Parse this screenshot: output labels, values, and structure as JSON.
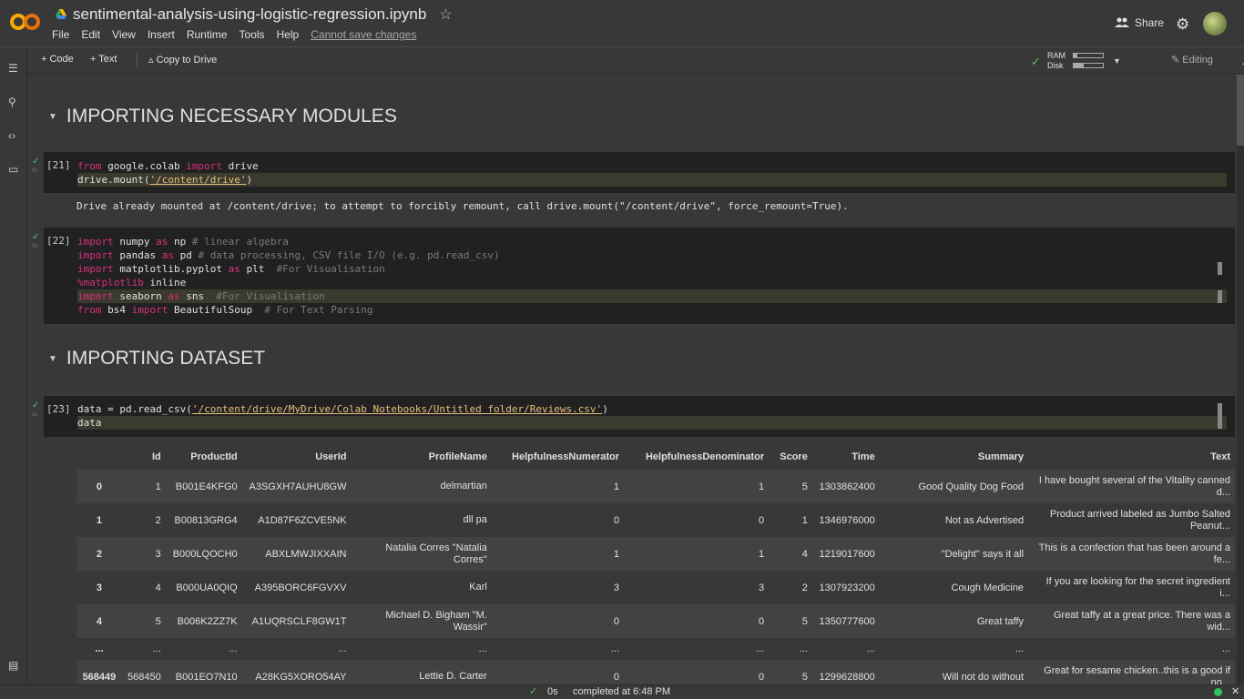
{
  "header": {
    "title": "sentimental-analysis-using-logistic-regression.ipynb",
    "menu": [
      "File",
      "Edit",
      "View",
      "Insert",
      "Runtime",
      "Tools",
      "Help"
    ],
    "cannot_save": "Cannot save changes",
    "share_label": "Share"
  },
  "toolbar": {
    "code_label": "Code",
    "text_label": "Text",
    "copy_label": "Copy to Drive",
    "ram_label": "RAM",
    "disk_label": "Disk",
    "ram_fraction": 0.12,
    "disk_fraction": 0.35,
    "editing_label": "Editing"
  },
  "sections": {
    "s1": "IMPORTING NECESSARY MODULES",
    "s2": "IMPORTING DATASET"
  },
  "cells": {
    "c21": {
      "exec": "[21]",
      "output": "Drive already mounted at /content/drive; to attempt to forcibly remount, call drive.mount(\"/content/drive\", force_remount=True)."
    },
    "c22": {
      "exec": "[22]"
    },
    "c23": {
      "exec": "[23]"
    }
  },
  "table": {
    "columns": [
      "",
      "Id",
      "ProductId",
      "UserId",
      "ProfileName",
      "HelpfulnessNumerator",
      "HelpfulnessDenominator",
      "Score",
      "Time",
      "Summary",
      "Text"
    ],
    "rows": [
      [
        "0",
        "1",
        "B001E4KFG0",
        "A3SGXH7AUHU8GW",
        "delmartian",
        "1",
        "1",
        "5",
        "1303862400",
        "Good Quality Dog Food",
        "I have bought several of the Vitality canned d..."
      ],
      [
        "1",
        "2",
        "B00813GRG4",
        "A1D87F6ZCVE5NK",
        "dll pa",
        "0",
        "0",
        "1",
        "1346976000",
        "Not as Advertised",
        "Product arrived labeled as Jumbo Salted Peanut..."
      ],
      [
        "2",
        "3",
        "B000LQOCH0",
        "ABXLMWJIXXAIN",
        "Natalia Corres \"Natalia Corres\"",
        "1",
        "1",
        "4",
        "1219017600",
        "\"Delight\" says it all",
        "This is a confection that has been around a fe..."
      ],
      [
        "3",
        "4",
        "B000UA0QIQ",
        "A395BORC6FGVXV",
        "Karl",
        "3",
        "3",
        "2",
        "1307923200",
        "Cough Medicine",
        "If you are looking for the secret ingredient i..."
      ],
      [
        "4",
        "5",
        "B006K2ZZ7K",
        "A1UQRSCLF8GW1T",
        "Michael D. Bigham \"M. Wassir\"",
        "0",
        "0",
        "5",
        "1350777600",
        "Great taffy",
        "Great taffy at a great price. There was a wid..."
      ],
      [
        "...",
        "...",
        "...",
        "...",
        "...",
        "...",
        "...",
        "...",
        "...",
        "...",
        "..."
      ],
      [
        "568449",
        "568450",
        "B001EO7N10",
        "A28KG5XORO54AY",
        "Lettie D. Carter",
        "0",
        "0",
        "5",
        "1299628800",
        "Will not do without",
        "Great for sesame chicken..this is a good if no..."
      ]
    ]
  },
  "status": {
    "time": "0s",
    "completed": "completed at 6:48 PM"
  }
}
